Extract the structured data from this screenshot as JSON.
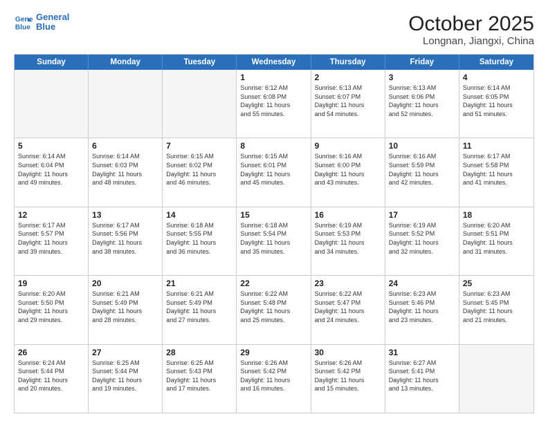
{
  "logo": {
    "line1": "General",
    "line2": "Blue"
  },
  "title": "October 2025",
  "subtitle": "Longnan, Jiangxi, China",
  "header_days": [
    "Sunday",
    "Monday",
    "Tuesday",
    "Wednesday",
    "Thursday",
    "Friday",
    "Saturday"
  ],
  "weeks": [
    [
      {
        "day": "",
        "info": ""
      },
      {
        "day": "",
        "info": ""
      },
      {
        "day": "",
        "info": ""
      },
      {
        "day": "1",
        "info": "Sunrise: 6:12 AM\nSunset: 6:08 PM\nDaylight: 11 hours\nand 55 minutes."
      },
      {
        "day": "2",
        "info": "Sunrise: 6:13 AM\nSunset: 6:07 PM\nDaylight: 11 hours\nand 54 minutes."
      },
      {
        "day": "3",
        "info": "Sunrise: 6:13 AM\nSunset: 6:06 PM\nDaylight: 11 hours\nand 52 minutes."
      },
      {
        "day": "4",
        "info": "Sunrise: 6:14 AM\nSunset: 6:05 PM\nDaylight: 11 hours\nand 51 minutes."
      }
    ],
    [
      {
        "day": "5",
        "info": "Sunrise: 6:14 AM\nSunset: 6:04 PM\nDaylight: 11 hours\nand 49 minutes."
      },
      {
        "day": "6",
        "info": "Sunrise: 6:14 AM\nSunset: 6:03 PM\nDaylight: 11 hours\nand 48 minutes."
      },
      {
        "day": "7",
        "info": "Sunrise: 6:15 AM\nSunset: 6:02 PM\nDaylight: 11 hours\nand 46 minutes."
      },
      {
        "day": "8",
        "info": "Sunrise: 6:15 AM\nSunset: 6:01 PM\nDaylight: 11 hours\nand 45 minutes."
      },
      {
        "day": "9",
        "info": "Sunrise: 6:16 AM\nSunset: 6:00 PM\nDaylight: 11 hours\nand 43 minutes."
      },
      {
        "day": "10",
        "info": "Sunrise: 6:16 AM\nSunset: 5:59 PM\nDaylight: 11 hours\nand 42 minutes."
      },
      {
        "day": "11",
        "info": "Sunrise: 6:17 AM\nSunset: 5:58 PM\nDaylight: 11 hours\nand 41 minutes."
      }
    ],
    [
      {
        "day": "12",
        "info": "Sunrise: 6:17 AM\nSunset: 5:57 PM\nDaylight: 11 hours\nand 39 minutes."
      },
      {
        "day": "13",
        "info": "Sunrise: 6:17 AM\nSunset: 5:56 PM\nDaylight: 11 hours\nand 38 minutes."
      },
      {
        "day": "14",
        "info": "Sunrise: 6:18 AM\nSunset: 5:55 PM\nDaylight: 11 hours\nand 36 minutes."
      },
      {
        "day": "15",
        "info": "Sunrise: 6:18 AM\nSunset: 5:54 PM\nDaylight: 11 hours\nand 35 minutes."
      },
      {
        "day": "16",
        "info": "Sunrise: 6:19 AM\nSunset: 5:53 PM\nDaylight: 11 hours\nand 34 minutes."
      },
      {
        "day": "17",
        "info": "Sunrise: 6:19 AM\nSunset: 5:52 PM\nDaylight: 11 hours\nand 32 minutes."
      },
      {
        "day": "18",
        "info": "Sunrise: 6:20 AM\nSunset: 5:51 PM\nDaylight: 11 hours\nand 31 minutes."
      }
    ],
    [
      {
        "day": "19",
        "info": "Sunrise: 6:20 AM\nSunset: 5:50 PM\nDaylight: 11 hours\nand 29 minutes."
      },
      {
        "day": "20",
        "info": "Sunrise: 6:21 AM\nSunset: 5:49 PM\nDaylight: 11 hours\nand 28 minutes."
      },
      {
        "day": "21",
        "info": "Sunrise: 6:21 AM\nSunset: 5:49 PM\nDaylight: 11 hours\nand 27 minutes."
      },
      {
        "day": "22",
        "info": "Sunrise: 6:22 AM\nSunset: 5:48 PM\nDaylight: 11 hours\nand 25 minutes."
      },
      {
        "day": "23",
        "info": "Sunrise: 6:22 AM\nSunset: 5:47 PM\nDaylight: 11 hours\nand 24 minutes."
      },
      {
        "day": "24",
        "info": "Sunrise: 6:23 AM\nSunset: 5:46 PM\nDaylight: 11 hours\nand 23 minutes."
      },
      {
        "day": "25",
        "info": "Sunrise: 6:23 AM\nSunset: 5:45 PM\nDaylight: 11 hours\nand 21 minutes."
      }
    ],
    [
      {
        "day": "26",
        "info": "Sunrise: 6:24 AM\nSunset: 5:44 PM\nDaylight: 11 hours\nand 20 minutes."
      },
      {
        "day": "27",
        "info": "Sunrise: 6:25 AM\nSunset: 5:44 PM\nDaylight: 11 hours\nand 19 minutes."
      },
      {
        "day": "28",
        "info": "Sunrise: 6:25 AM\nSunset: 5:43 PM\nDaylight: 11 hours\nand 17 minutes."
      },
      {
        "day": "29",
        "info": "Sunrise: 6:26 AM\nSunset: 5:42 PM\nDaylight: 11 hours\nand 16 minutes."
      },
      {
        "day": "30",
        "info": "Sunrise: 6:26 AM\nSunset: 5:42 PM\nDaylight: 11 hours\nand 15 minutes."
      },
      {
        "day": "31",
        "info": "Sunrise: 6:27 AM\nSunset: 5:41 PM\nDaylight: 11 hours\nand 13 minutes."
      },
      {
        "day": "",
        "info": ""
      }
    ]
  ]
}
